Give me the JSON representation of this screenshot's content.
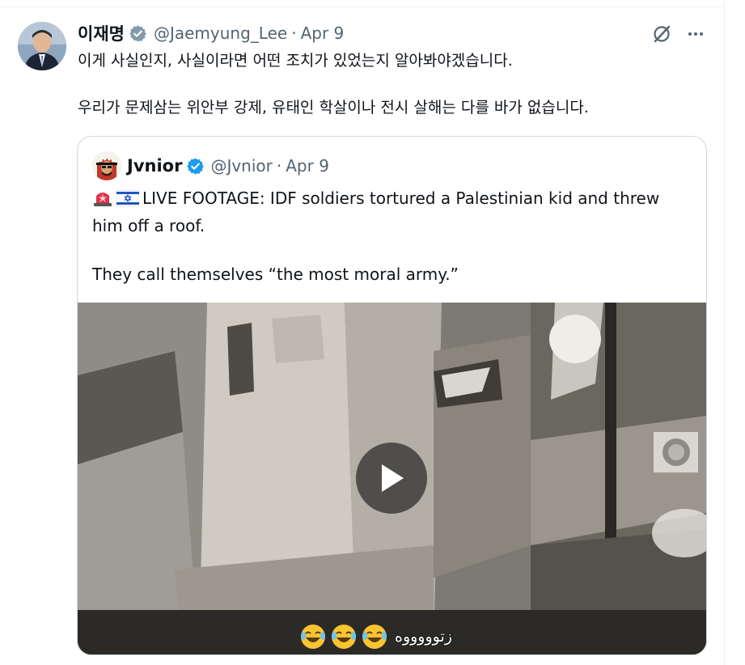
{
  "tweet": {
    "author_name": "이재명",
    "handle": "@Jaemyung_Lee",
    "separator": "·",
    "date": "Apr 9",
    "text_line1": "이게 사실인지, 사실이라면 어떤 조치가 있었는지 알아봐야겠습니다.",
    "text_line2": "우리가 문제삼는 위안부 강제, 유태인 학살이나 전시 살해는 다를 바가 없습니다.",
    "avatar_icon": "profile-photo",
    "verified_icon": "gray-verified-badge",
    "verified_color": "#829aab"
  },
  "actions": {
    "grok_icon": "grok-icon",
    "more_icon": "more-dots-icon"
  },
  "quote": {
    "author_name": "Jvnior",
    "handle": "@Jvnior",
    "separator": "·",
    "date": "Apr 9",
    "text_line1": "LIVE FOOTAGE: IDF soldiers tortured a Palestinian kid and threw him off a roof.",
    "text_line2": "They call themselves “the most moral army.”",
    "emoji1": "police-light-emoji",
    "emoji2": "israel-flag-emoji",
    "verified_icon": "blue-verified-badge",
    "verified_color": "#1d9bf0"
  },
  "video": {
    "play_icon": "play-icon",
    "caption": "زتوووووه",
    "caption_emoji": "laughing-crying-emoji"
  }
}
